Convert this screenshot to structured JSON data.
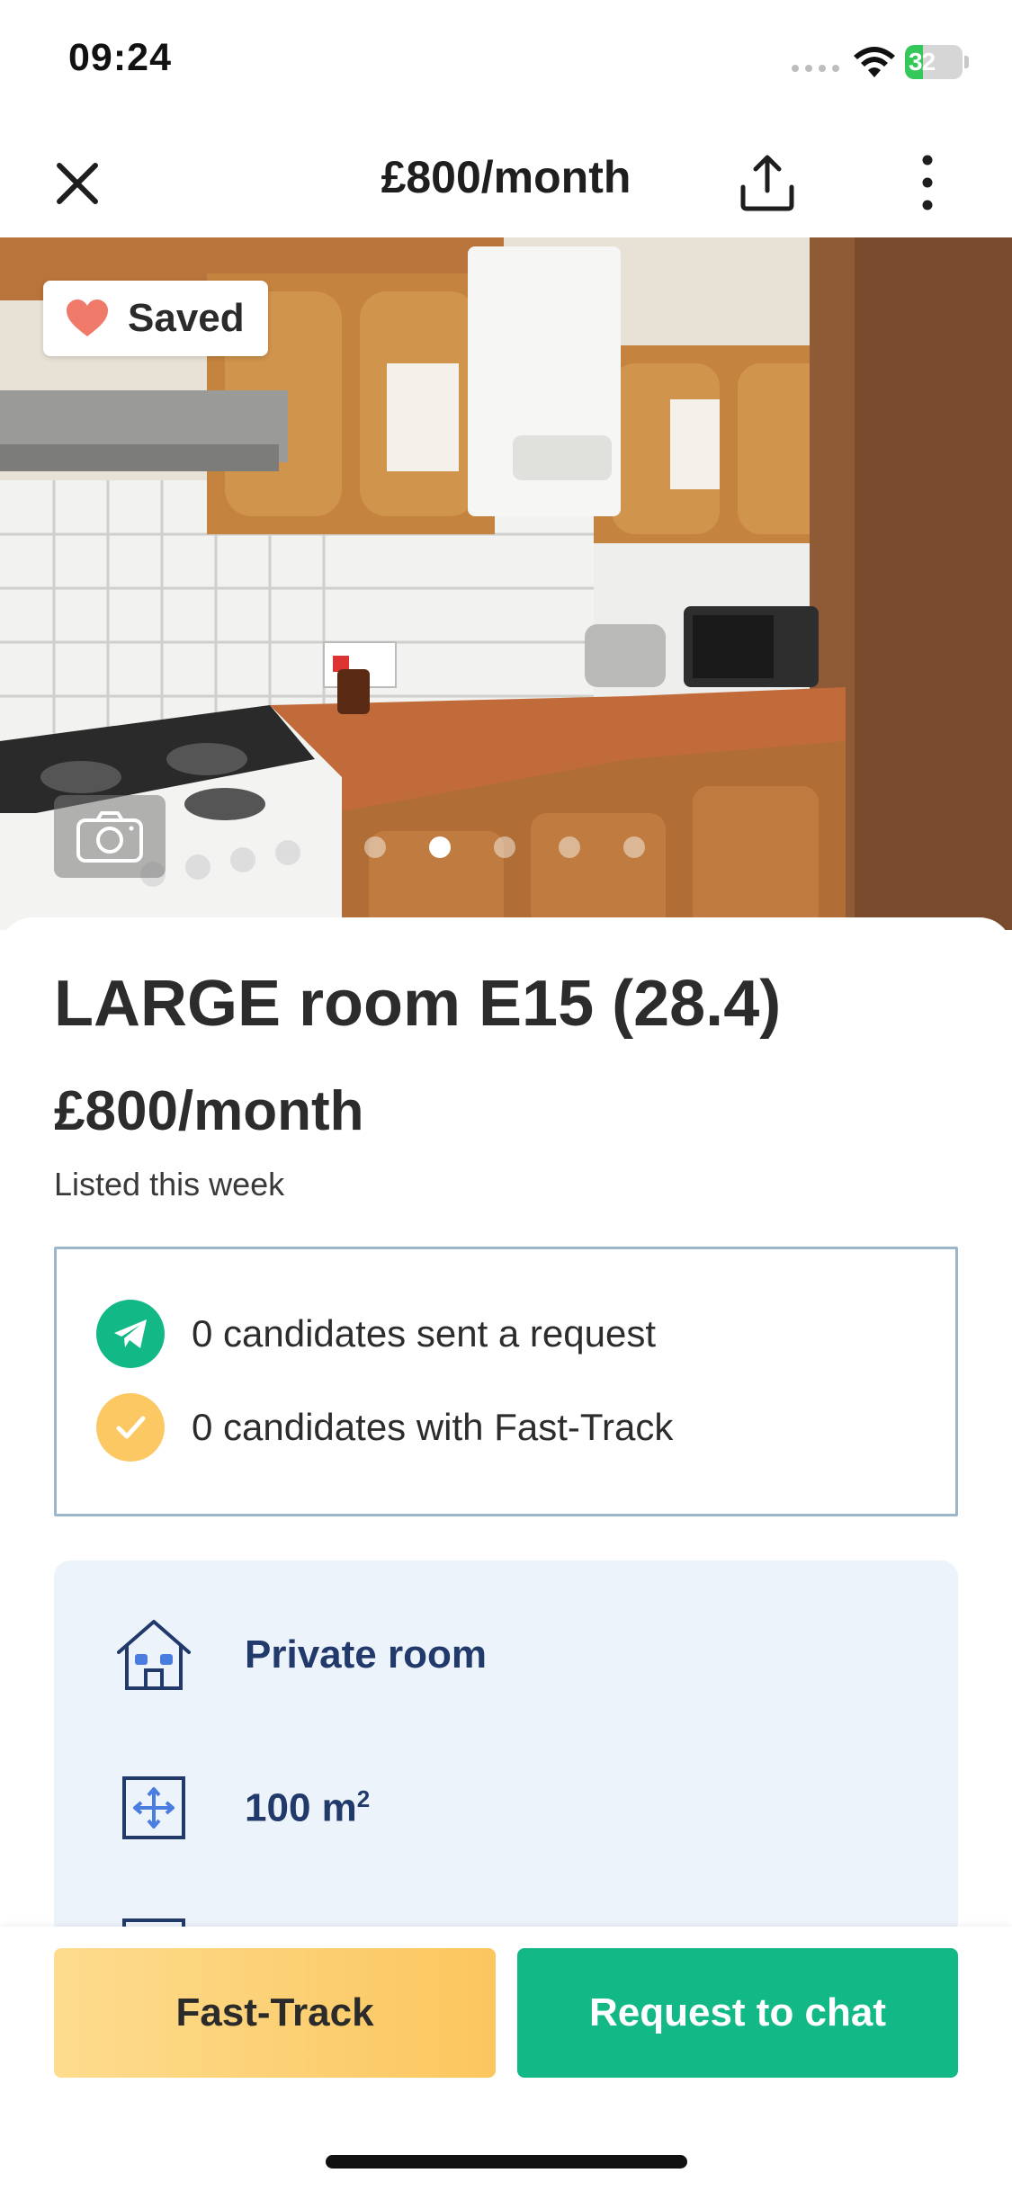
{
  "status_bar": {
    "time": "09:24",
    "battery_percent": "32",
    "battery_level": 0.32,
    "battery_charging": true
  },
  "nav": {
    "title": "£800/month",
    "icons": [
      "close-icon",
      "share-icon",
      "more-icon"
    ]
  },
  "hero": {
    "saved_label": "Saved",
    "photo_count": 5,
    "active_photo_index": 1
  },
  "listing": {
    "title": "LARGE room E15 (28.4)",
    "price": "£800/month",
    "listed": "Listed this week"
  },
  "candidates": {
    "requests_text": "0 candidates sent a request",
    "fasttrack_text": "0 candidates with Fast-Track"
  },
  "features": {
    "room_type": "Private room",
    "size_value": "100 m",
    "size_unit_sup": "2"
  },
  "actions": {
    "fast_track_label": "Fast-Track",
    "request_chat_label": "Request to chat"
  },
  "colors": {
    "primary_green": "#12b886",
    "fast_track_yellow": "#fcc65e",
    "feature_text_navy": "#213a6b",
    "feature_box_bg": "#edf3fa",
    "heart_coral": "#f07a6a"
  }
}
